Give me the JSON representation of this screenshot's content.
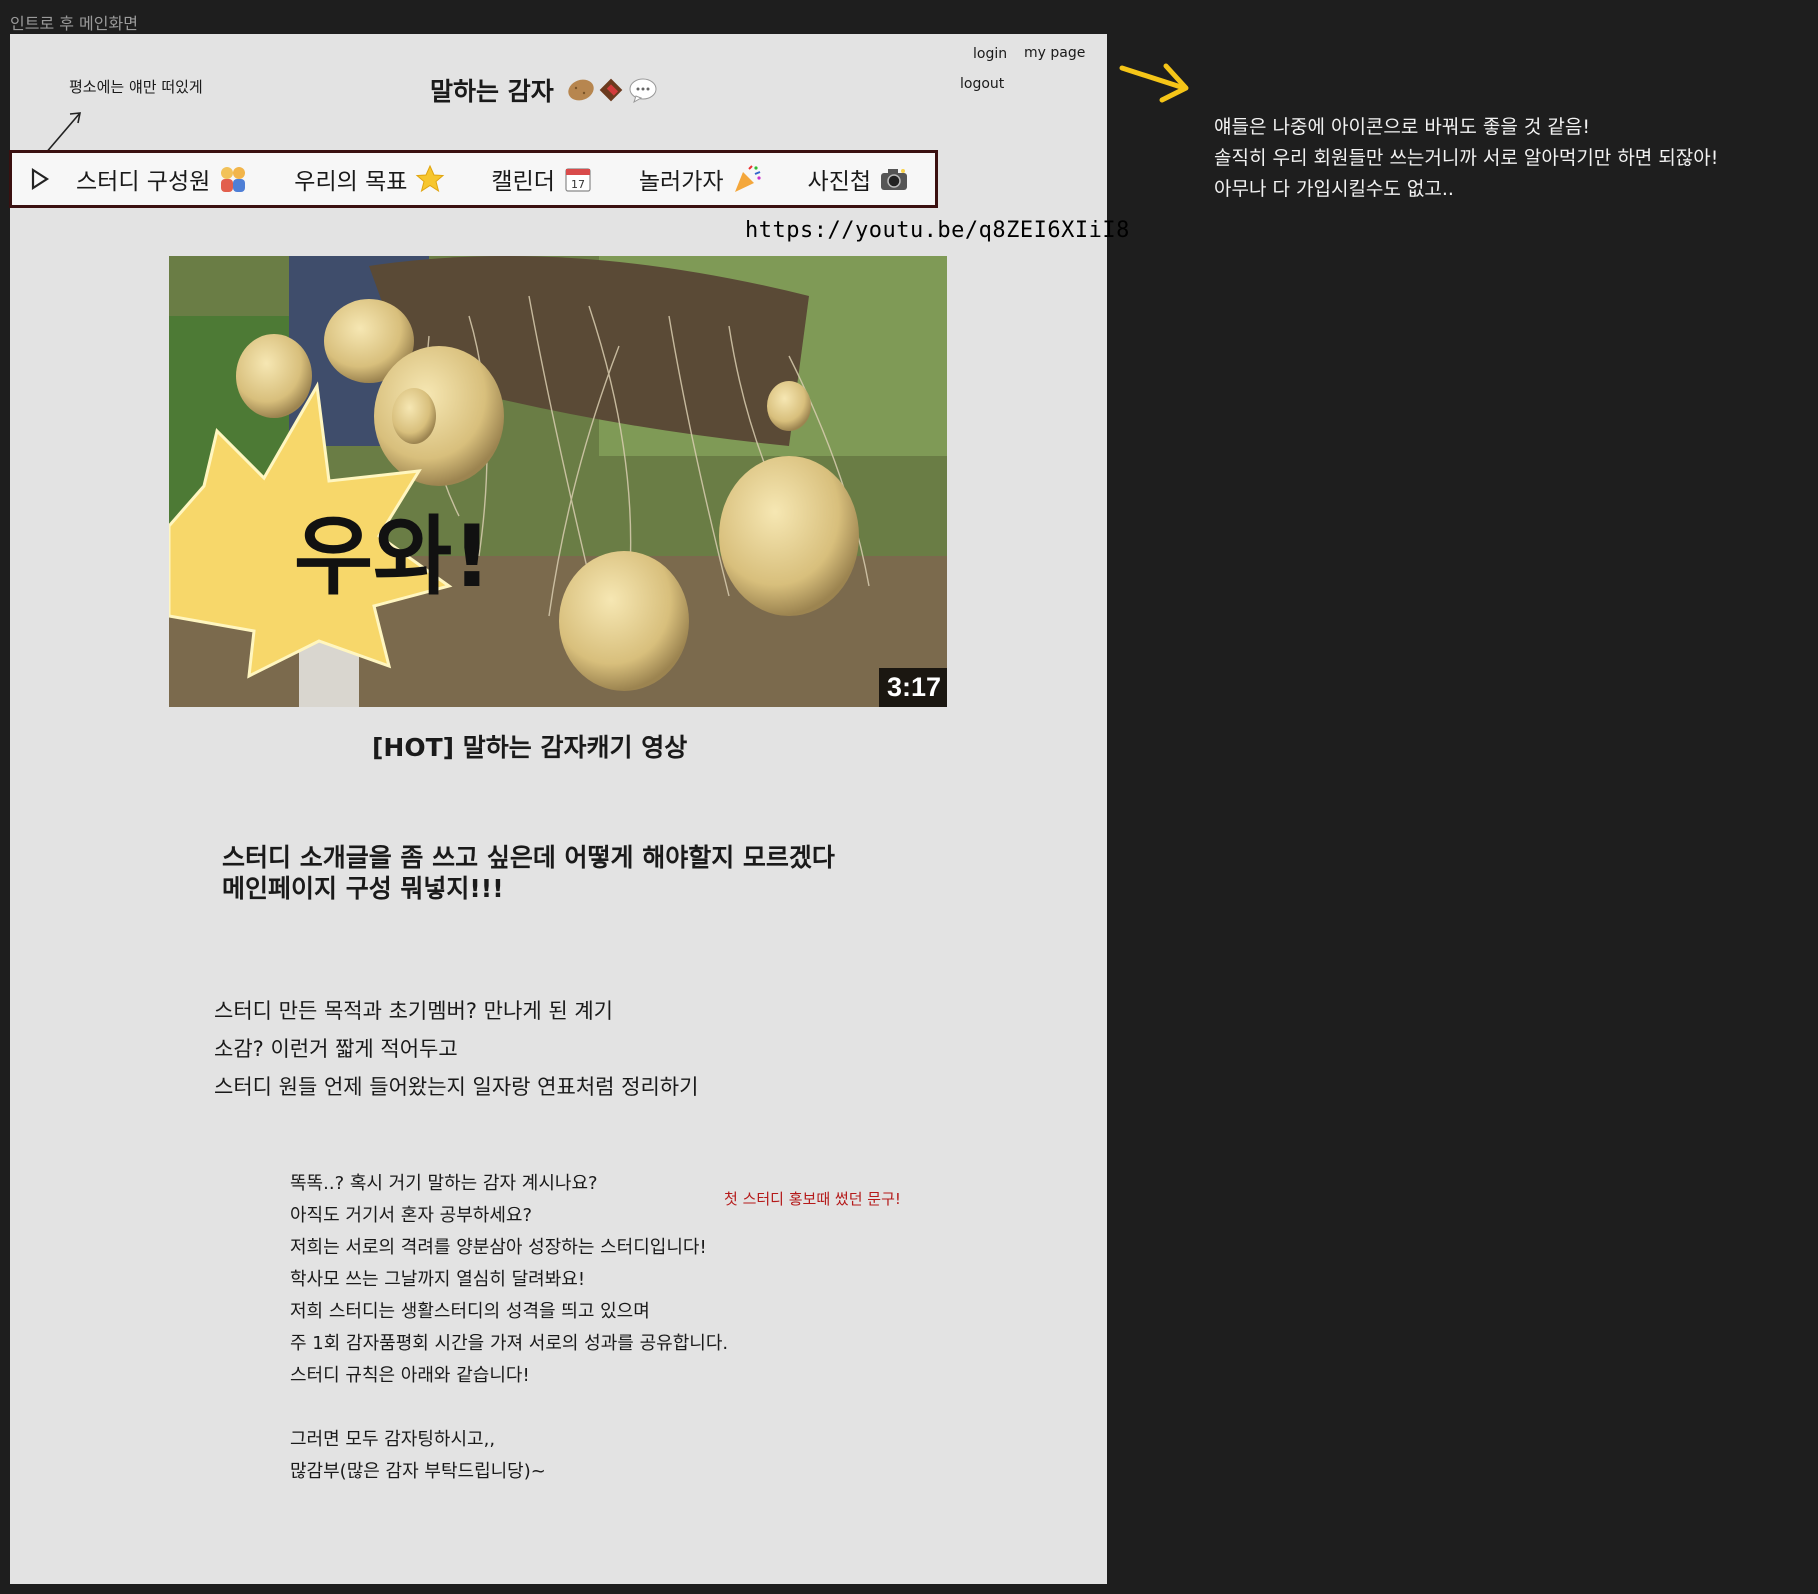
{
  "frame": {
    "label": "인트로 후 메인화면"
  },
  "annotation_top": "평소에는 얘만 떠있게",
  "header": {
    "title": "말하는 감자",
    "login": "login",
    "mypage": "my page",
    "logout": "logout"
  },
  "nav": {
    "items": [
      {
        "label": "스터디 구성원",
        "icon": "people-emoji-icon"
      },
      {
        "label": "우리의 목표",
        "icon": "star-emoji-icon"
      },
      {
        "label": "캘린더",
        "icon": "calendar-emoji-icon"
      },
      {
        "label": "놀러가자",
        "icon": "party-popper-emoji-icon"
      },
      {
        "label": "사진첩",
        "icon": "camera-emoji-icon"
      }
    ]
  },
  "video": {
    "url": "https://youtu.be/q8ZEI6XIiI8",
    "thumbnail_text": "우와!",
    "duration": "3:17",
    "caption": "[HOT] 말하는 감자캐기 영상"
  },
  "headline": {
    "line1": "스터디 소개글을 좀 쓰고 싶은데 어떻게 해야할지 모르겠다",
    "line2": "메인페이지 구성 뭐넣지!!!"
  },
  "plan_lines": [
    "스터디 만든 목적과 초기멤버? 만나게 된 계기",
    "소감? 이런거 짧게 적어두고",
    "스터디 원들 언제 들어왔는지 일자랑 연표처럼 정리하기"
  ],
  "intro_lines": [
    "똑똑..? 혹시 거기 말하는 감자 계시나요?",
    "아직도 거기서 혼자 공부하세요?",
    "저희는 서로의 격려를 양분삼아 성장하는 스터디입니다!",
    "학사모 쓰는 그날까지 열심히 달려봐요!",
    "저희 스터디는 생활스터디의 성격을 띄고 있으며",
    "주 1회 감자품평회 시간을 가져 서로의 성과를 공유합니다.",
    "스터디 규칙은 아래와 같습니다!",
    "그러면 모두 감자팅하시고,,",
    "많감부(많은 감자 부탁드립니당)~"
  ],
  "red_note": "첫 스터디 홍보때 썼던 문구!",
  "right_notes": [
    "얘들은 나중에 아이콘으로 바꿔도 좋을 것 같음!",
    "솔직히 우리 회원들만 쓰는거니까 서로 알아먹기만 하면 되잖아!",
    "아무나 다 가입시킬수도 없고.."
  ],
  "colors": {
    "page_bg": "#1e1e1e",
    "canvas_bg": "#e3e3e3",
    "nav_border": "#3a1010",
    "note_red": "#b51a1a",
    "arrow_yellow": "#f5c518"
  }
}
